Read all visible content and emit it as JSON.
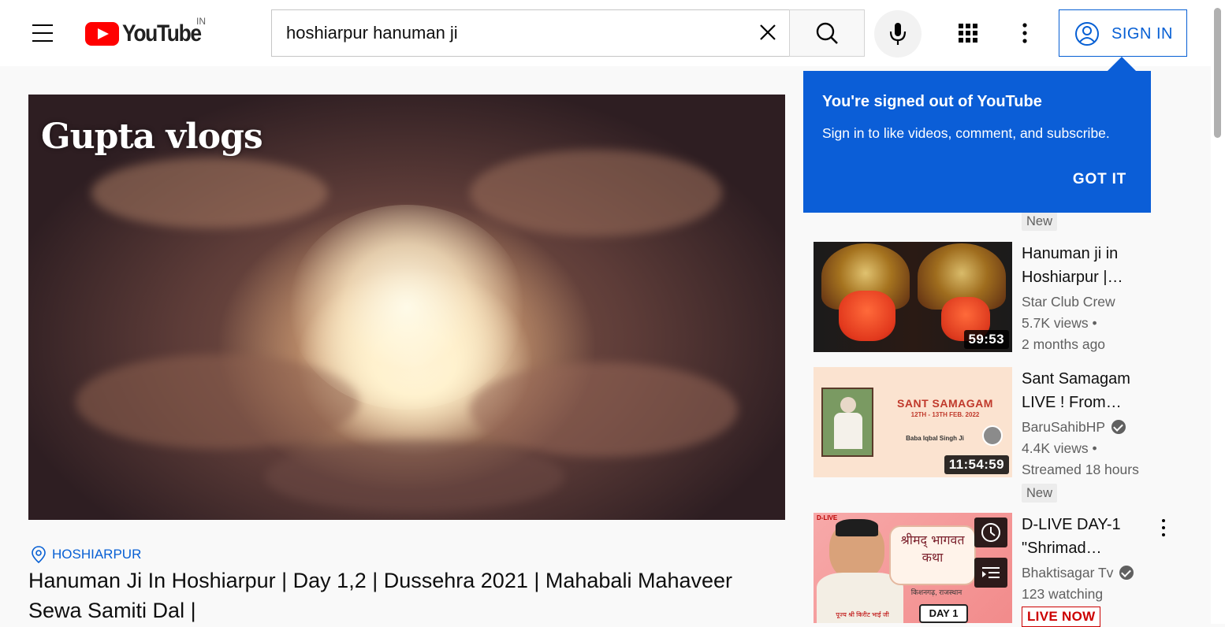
{
  "header": {
    "logo_text": "YouTube",
    "country_code": "IN",
    "search_value": "hoshiarpur hanuman ji",
    "signin_label": "SIGN IN"
  },
  "player": {
    "watermark": "Gupta vlogs"
  },
  "video": {
    "location": "HOSHIARPUR",
    "title": "Hanuman Ji In Hoshiarpur | Day 1,2 | Dussehra 2021 | Mahabali Mahaveer Sewa Samiti Dal |"
  },
  "popup": {
    "title": "You're signed out of YouTube",
    "text": "Sign in to like videos, comment, and subscribe.",
    "button": "GOT IT"
  },
  "sidebar": {
    "top_badge": "New",
    "items": [
      {
        "title": "Hanuman ji in Hoshiarpur |…",
        "channel": "Star Club Crew",
        "views": "5.7K views •",
        "age": "2 months ago",
        "duration": "59:53"
      },
      {
        "title": "Sant Samagam LIVE ! From…",
        "channel": "BaruSahibHP",
        "views": "4.4K views •",
        "age": "Streamed 18 hours",
        "duration": "11:54:59",
        "badge": "New",
        "thumb_heading": "SANT SAMAGAM",
        "thumb_date": "12TH - 13TH FEB. 2022",
        "thumb_name": "Baba Iqbal Singh Ji"
      },
      {
        "title": "D-LIVE DAY-1 \"Shrimad…",
        "channel": "Bhaktisagar Tv",
        "views": "123 watching",
        "live_label": "LIVE NOW",
        "thumb_tag": "D-LIVE",
        "thumb_heading": "श्रीमद् भागवत कथा",
        "thumb_place": "किशनगढ़, राजस्थान",
        "thumb_day": "DAY 1",
        "thumb_speaker": "पूज्य श्री किरीट भाई जी"
      }
    ]
  }
}
